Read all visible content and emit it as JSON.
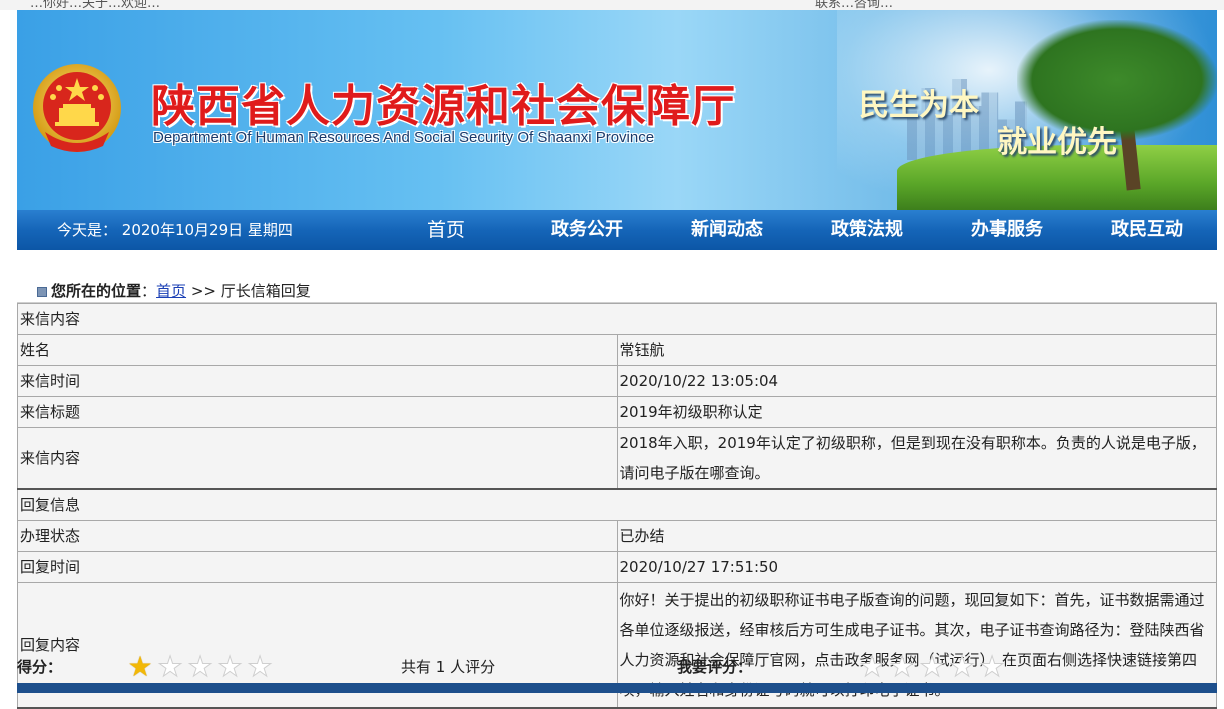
{
  "top": {
    "left_text": "…你好…关于…欢迎…",
    "right_text": "联系…咨询…"
  },
  "banner": {
    "title_cn": "陕西省人力资源和社会保障厅",
    "title_en": "Department Of Human Resources And Social Security Of Shaanxi Province",
    "slogan_1": "民生为本",
    "slogan_2": "就业优先"
  },
  "nav": {
    "date_label": "今天是：",
    "date_value": "2020年10月29日 星期四",
    "items": [
      {
        "label": "首页"
      },
      {
        "label": "政务公开"
      },
      {
        "label": "新闻动态"
      },
      {
        "label": "政策法规"
      },
      {
        "label": "办事服务"
      },
      {
        "label": "政民互动"
      }
    ]
  },
  "breadcrumb": {
    "label": "您所在的位置",
    "sep": "：",
    "home": "首页",
    "arrow": " >> ",
    "current": "厅长信箱回复"
  },
  "letter": {
    "section_title": "来信内容",
    "name_label": "姓名",
    "name_value": "常钰航",
    "time_label": "来信时间",
    "time_value": "2020/10/22 13:05:04",
    "subject_label": "来信标题",
    "subject_value": "2019年初级职称认定",
    "content_label": "来信内容",
    "content_value": "2018年入职，2019年认定了初级职称，但是到现在没有职称本。负责的人说是电子版，请问电子版在哪查询。"
  },
  "reply": {
    "section_title": "回复信息",
    "status_label": "办理状态",
    "status_value": "已办结",
    "time_label": "回复时间",
    "time_value": "2020/10/27 17:51:50",
    "content_label": "回复内容",
    "content_value": "你好！关于提出的初级职称证书电子版查询的问题，现回复如下：首先，证书数据需通过各单位逐级报送，经审核后方可生成电子证书。其次，电子证书查询路径为：登陆陕西省人力资源和社会保障厅官网，点击政务服务网（试运行），在页面右侧选择快速链接第四项，输入姓名和身份证号码就可以打印电子证书。"
  },
  "rating": {
    "score_label": "得分：",
    "score_value": 1,
    "max": 5,
    "count_text": "共有 1 人评分",
    "my_label": "我要评分：",
    "my_value": 0
  },
  "colors": {
    "title_red": "#e01b1b",
    "nav_blue": "#1565b8",
    "star_gold": "#f2b807",
    "link_blue": "#1a3fb5"
  }
}
